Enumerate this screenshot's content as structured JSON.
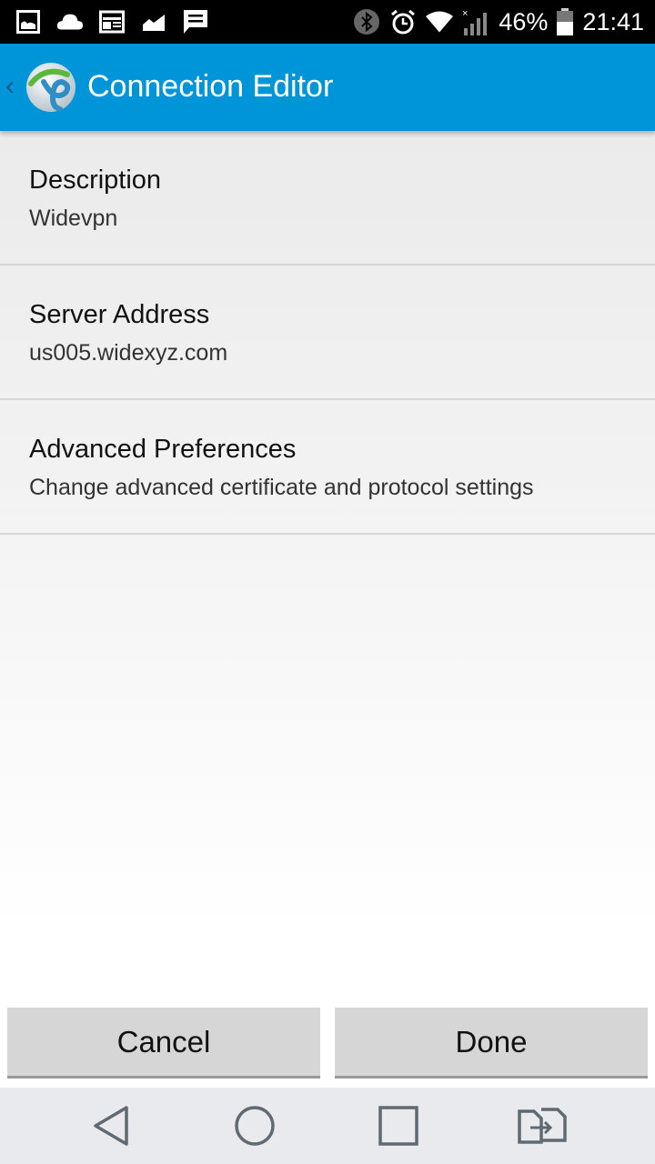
{
  "status_bar": {
    "notification_icons": [
      "gallery-icon",
      "cloud-icon",
      "news-icon",
      "chart-icon",
      "message-icon"
    ],
    "system_icons": [
      "bluetooth-icon",
      "alarm-icon",
      "wifi-icon",
      "signal-icon",
      "battery-icon"
    ],
    "battery_percent": "46%",
    "time": "21:41"
  },
  "app_bar": {
    "title": "Connection Editor",
    "colors": {
      "background": "#0095d8",
      "title": "#ffffff"
    }
  },
  "preferences": [
    {
      "title": "Description",
      "value": "Widevpn"
    },
    {
      "title": "Server Address",
      "value": "us005.widexyz.com"
    },
    {
      "title": "Advanced Preferences",
      "value": "Change advanced certificate and protocol settings"
    }
  ],
  "buttons": {
    "cancel": "Cancel",
    "done": "Done"
  },
  "nav_bar": {
    "icons": [
      "back-icon",
      "home-icon",
      "recents-icon",
      "switch-sim-icon"
    ]
  }
}
